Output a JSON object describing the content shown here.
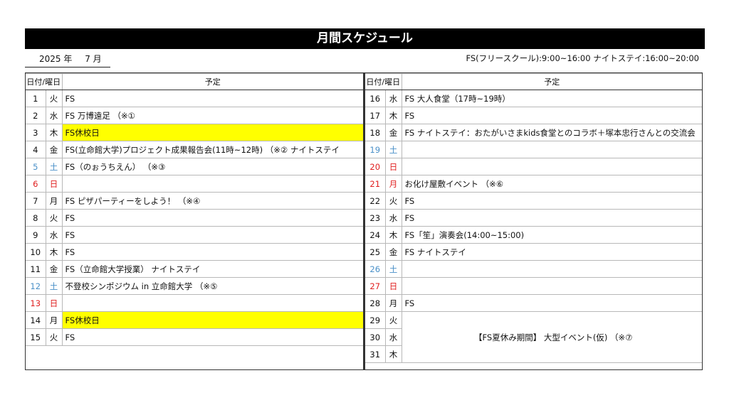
{
  "title": "月間スケジュール",
  "year_label": "2025 年",
  "month_label": "7 月",
  "hours_note": "FS(フリースクール):9:00~16:00  ナイトステイ:16:00~20:00",
  "table_headers": {
    "date_dow": "日付/曜日",
    "plan": "予定"
  },
  "colors": {
    "saturday": "#4a90c8",
    "sunday": "#e02020",
    "holiday_highlight": "#ffff00"
  },
  "left_rows": [
    {
      "day": "1",
      "dow": "火",
      "plan": "FS",
      "type": "weekday",
      "highlight": false
    },
    {
      "day": "2",
      "dow": "水",
      "plan": "FS  万博遠足  （※①",
      "type": "weekday",
      "highlight": false
    },
    {
      "day": "3",
      "dow": "木",
      "plan": "FS休校日",
      "type": "weekday",
      "highlight": true
    },
    {
      "day": "4",
      "dow": "金",
      "plan": "FS(立命館大学)プロジェクト成果報告会(11時~12時) （※②  ナイトステイ",
      "type": "weekday",
      "highlight": false
    },
    {
      "day": "5",
      "dow": "土",
      "plan": "FS（のぉうちえん）  （※③",
      "type": "sat",
      "highlight": false
    },
    {
      "day": "6",
      "dow": "日",
      "plan": "",
      "type": "sun",
      "highlight": false
    },
    {
      "day": "7",
      "dow": "月",
      "plan": "FS  ピザパーティーをしよう！  （※④",
      "type": "weekday",
      "highlight": false
    },
    {
      "day": "8",
      "dow": "火",
      "plan": "FS",
      "type": "weekday",
      "highlight": false
    },
    {
      "day": "9",
      "dow": "水",
      "plan": "FS",
      "type": "weekday",
      "highlight": false
    },
    {
      "day": "10",
      "dow": "木",
      "plan": "FS",
      "type": "weekday",
      "highlight": false
    },
    {
      "day": "11",
      "dow": "金",
      "plan": "FS（立命館大学授業）  ナイトステイ",
      "type": "weekday",
      "highlight": false
    },
    {
      "day": "12",
      "dow": "土",
      "plan": "不登校シンポジウム  in  立命館大学  （※⑤",
      "type": "sat",
      "highlight": false
    },
    {
      "day": "13",
      "dow": "日",
      "plan": "",
      "type": "sun",
      "highlight": false
    },
    {
      "day": "14",
      "dow": "月",
      "plan": "FS休校日",
      "type": "weekday",
      "highlight": true
    },
    {
      "day": "15",
      "dow": "火",
      "plan": "FS",
      "type": "weekday",
      "highlight": false
    }
  ],
  "right_rows": [
    {
      "day": "16",
      "dow": "水",
      "plan": "FS  大人食堂（17時~19時）",
      "type": "weekday"
    },
    {
      "day": "17",
      "dow": "木",
      "plan": "FS",
      "type": "weekday"
    },
    {
      "day": "18",
      "dow": "金",
      "plan": "FS  ナイトステイ：おたがいさまkids食堂とのコラボ＋塚本忠行さんとの交流会",
      "type": "weekday"
    },
    {
      "day": "19",
      "dow": "土",
      "plan": "",
      "type": "sat"
    },
    {
      "day": "20",
      "dow": "日",
      "plan": "",
      "type": "sun"
    },
    {
      "day": "21",
      "dow": "月",
      "plan": "お化け屋敷イベント  （※⑥",
      "type": "holiday"
    },
    {
      "day": "22",
      "dow": "火",
      "plan": "FS",
      "type": "weekday"
    },
    {
      "day": "23",
      "dow": "水",
      "plan": "FS",
      "type": "weekday"
    },
    {
      "day": "24",
      "dow": "木",
      "plan": "FS「笙」演奏会(14:00~15:00)",
      "type": "weekday"
    },
    {
      "day": "25",
      "dow": "金",
      "plan": "FS  ナイトステイ",
      "type": "weekday"
    },
    {
      "day": "26",
      "dow": "土",
      "plan": "",
      "type": "sat"
    },
    {
      "day": "27",
      "dow": "日",
      "plan": "",
      "type": "sun"
    },
    {
      "day": "28",
      "dow": "月",
      "plan": "FS",
      "type": "weekday"
    }
  ],
  "summer_block": {
    "rows": [
      {
        "day": "29",
        "dow": "火"
      },
      {
        "day": "30",
        "dow": "水"
      },
      {
        "day": "31",
        "dow": "木"
      }
    ],
    "plan": "【FS夏休み期間】 大型イベント(仮) （※⑦"
  }
}
